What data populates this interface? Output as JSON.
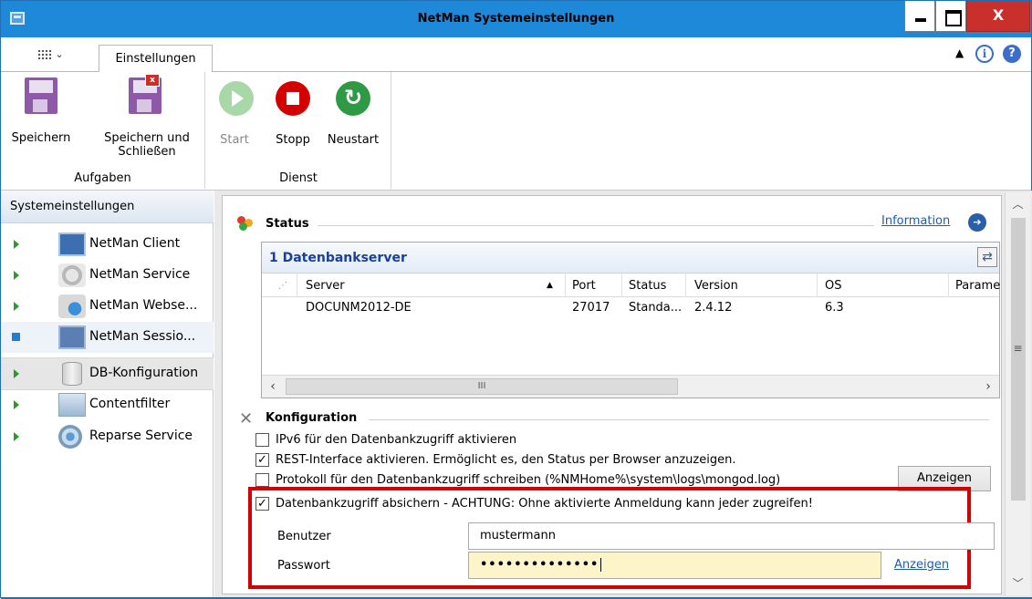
{
  "window": {
    "title": "NetMan Systemeinstellungen",
    "close_label": "X"
  },
  "ribbon": {
    "tab_label": "Einstellungen",
    "groups": [
      {
        "label": "Aufgaben",
        "buttons": [
          {
            "label": "Speichern"
          },
          {
            "label": "Speichern und Schließen"
          }
        ]
      },
      {
        "label": "Dienst",
        "buttons": [
          {
            "label": "Start",
            "disabled": true
          },
          {
            "label": "Stopp"
          },
          {
            "label": "Neustart"
          }
        ]
      }
    ]
  },
  "nav": {
    "header": "Systemeinstellungen",
    "items": [
      {
        "label": "NetMan Client",
        "icon": "client-icon",
        "marker": "arrow"
      },
      {
        "label": "NetMan Service",
        "icon": "service-gear-icon",
        "marker": "arrow"
      },
      {
        "label": "NetMan Webse...",
        "icon": "webserver-icon",
        "marker": "arrow"
      },
      {
        "label": "NetMan Sessio...",
        "icon": "session-icon",
        "marker": "square"
      },
      {
        "label": "DB-Konfiguration",
        "icon": "database-icon",
        "marker": "arrow",
        "selected": true
      },
      {
        "label": "Contentfilter",
        "icon": "contentfilter-icon",
        "marker": "arrow"
      },
      {
        "label": "Reparse Service",
        "icon": "reparse-icon",
        "marker": "arrow"
      }
    ]
  },
  "status": {
    "heading": "Status",
    "info_link": "Information",
    "grid_title": "1 Datenbankserver",
    "columns": [
      "Server",
      "Port",
      "Status",
      "Version",
      "OS",
      "Parame"
    ],
    "rows": [
      [
        "DOCUNM2012-DE",
        "27017",
        "Standa...",
        "2.4.12",
        "6.3",
        ""
      ]
    ],
    "hscroll_grip": "III"
  },
  "konfiguration": {
    "heading": "Konfiguration",
    "options": [
      {
        "label": "IPv6 für den Datenbankzugriff aktivieren",
        "checked": false
      },
      {
        "label": "REST-Interface aktivieren. Ermöglicht es, den Status per Browser anzuzeigen.",
        "checked": true
      },
      {
        "label": "Protokoll für den Datenbankzugriff schreiben (%NMHome%\\system\\logs\\mongod.log)",
        "checked": false
      },
      {
        "label": "Datenbankzugriff absichern - ACHTUNG: Ohne aktivierte Anmeldung kann jeder zugreifen!",
        "checked": true
      }
    ],
    "log_button": "Anzeigen",
    "user_label": "Benutzer",
    "user_value": "mustermann",
    "password_label": "Passwort",
    "password_value": "••••••••••••••",
    "password_show": "Anzeigen"
  },
  "colors": {
    "titlebar": "#1e88d9",
    "highlight_frame": "#d40000",
    "link": "#1a5cb5",
    "password_bg": "#fdf5c9"
  }
}
